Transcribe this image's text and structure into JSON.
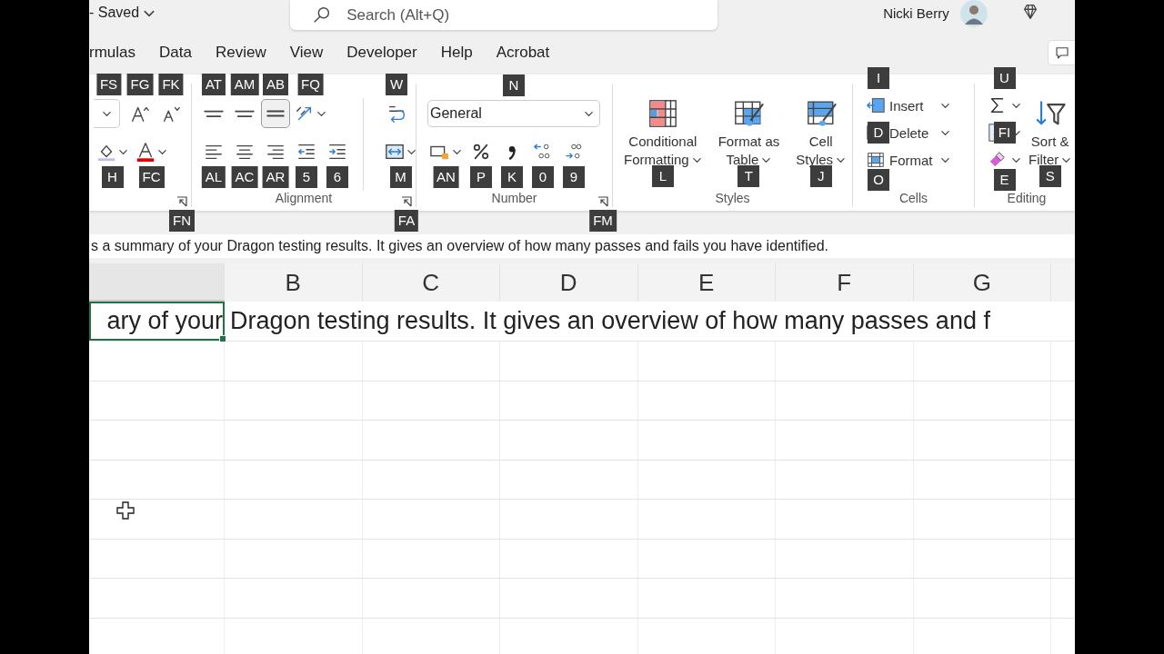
{
  "title_bar": {
    "save_status": "- Saved",
    "search": {
      "placeholder": "Search (Alt+Q)"
    },
    "user_name": "Nicki Berry"
  },
  "tabs": [
    {
      "label": "rmulas",
      "selected": false
    },
    {
      "label": "Data",
      "selected": false
    },
    {
      "label": "Review",
      "selected": false
    },
    {
      "label": "View",
      "selected": false
    },
    {
      "label": "Developer",
      "selected": false
    },
    {
      "label": "Help",
      "selected": false
    },
    {
      "label": "Acrobat",
      "selected": false
    }
  ],
  "ribbon": {
    "groups": [
      {
        "kind": "small",
        "sections": [
          {
            "rows": [
              [
                {
                  "kind": "font-size",
                  "keytip": "FS"
                },
                {
                  "kind": "grow-font",
                  "keytip": "FG"
                },
                {
                  "kind": "shrink-font",
                  "keytip": "FK"
                }
              ],
              [
                {
                  "kind": "fill-color",
                  "keytip": "H"
                },
                {
                  "kind": "font-color",
                  "keytip": "FC"
                }
              ]
            ]
          }
        ],
        "launcher_keytip": "FN"
      },
      {
        "kind": "small",
        "label": "Alignment",
        "sections": [
          {
            "rows": [
              [
                {
                  "kind": "align-top",
                  "keytip": "AT",
                  "selected": false
                },
                {
                  "kind": "align-middle",
                  "keytip": "AM",
                  "selected": false
                },
                {
                  "kind": "align-bottom",
                  "keytip": "AB",
                  "selected": true
                },
                {
                  "kind": "orientation",
                  "keytip": "FQ",
                  "selected": false
                }
              ],
              [
                {
                  "kind": "align-left",
                  "keytip": "AL",
                  "selected": false
                },
                {
                  "kind": "align-center",
                  "keytip": "AC",
                  "selected": false
                },
                {
                  "kind": "align-right",
                  "keytip": "AR",
                  "selected": false
                },
                {
                  "kind": "indent-decrease",
                  "keytip": "5",
                  "selected": false
                },
                {
                  "kind": "indent-increase",
                  "keytip": "6",
                  "selected": false
                }
              ]
            ]
          },
          {
            "rows": [
              [
                {
                  "kind": "wrap-text",
                  "keytip": "W"
                }
              ],
              [
                {
                  "kind": "merge",
                  "keytip": "M"
                }
              ]
            ]
          }
        ],
        "launcher_keytip": "FA"
      },
      {
        "kind": "small",
        "label": "Number",
        "sections": [
          {
            "rows": [
              [
                {
                  "kind": "number-format",
                  "value": "General",
                  "keytip": "N"
                }
              ],
              [
                {
                  "kind": "accounting",
                  "keytip": "AN"
                },
                {
                  "kind": "percent",
                  "keytip": "P"
                },
                {
                  "kind": "comma",
                  "keytip": "K"
                },
                {
                  "kind": "decimal-increase",
                  "keytip": "0"
                },
                {
                  "kind": "decimal-decrease",
                  "keytip": "9"
                }
              ]
            ]
          }
        ],
        "launcher_keytip": "FM"
      },
      {
        "kind": "large",
        "label": "Styles",
        "items": [
          {
            "kind": "conditional-formatting",
            "lines": [
              "Conditional",
              "Formatting"
            ],
            "keytip": "L"
          },
          {
            "kind": "format-as-table",
            "lines": [
              "Format as",
              "Table"
            ],
            "keytip": "T"
          },
          {
            "kind": "cell-styles",
            "lines": [
              "Cell",
              "Styles"
            ],
            "keytip": "J"
          }
        ]
      },
      {
        "kind": "list",
        "label": "Cells",
        "items": [
          {
            "kind": "insert",
            "label": "Insert",
            "keytip": "I"
          },
          {
            "kind": "delete",
            "label": "Delete",
            "keytip": "D"
          },
          {
            "kind": "format",
            "label": "Format",
            "keytip": "O"
          }
        ]
      },
      {
        "kind": "editing",
        "label": "Editing",
        "items": [
          {
            "kind": "autosum",
            "keytip": "U"
          },
          {
            "kind": "fill",
            "keytip": "FI"
          },
          {
            "kind": "clear",
            "keytip": "E"
          }
        ],
        "large": {
          "kind": "sort-filter",
          "lines": [
            "Sort &",
            "Filter"
          ],
          "keytip": "S"
        }
      }
    ]
  },
  "formula_bar": {
    "value": "s a summary of your Dragon testing results. It gives an overview of how many passes and fails you have identified."
  },
  "grid": {
    "columns": [
      {
        "active": true
      },
      {
        "label": "B",
        "active": false
      },
      {
        "label": "C",
        "active": false
      },
      {
        "label": "D",
        "active": false
      },
      {
        "label": "E",
        "active": false
      },
      {
        "label": "F",
        "active": false
      },
      {
        "label": "G",
        "active": false
      }
    ],
    "active_cell": {
      "value": "ary of your"
    },
    "overflow_text": "Dragon testing results. It gives an overview of how many passes and f"
  }
}
